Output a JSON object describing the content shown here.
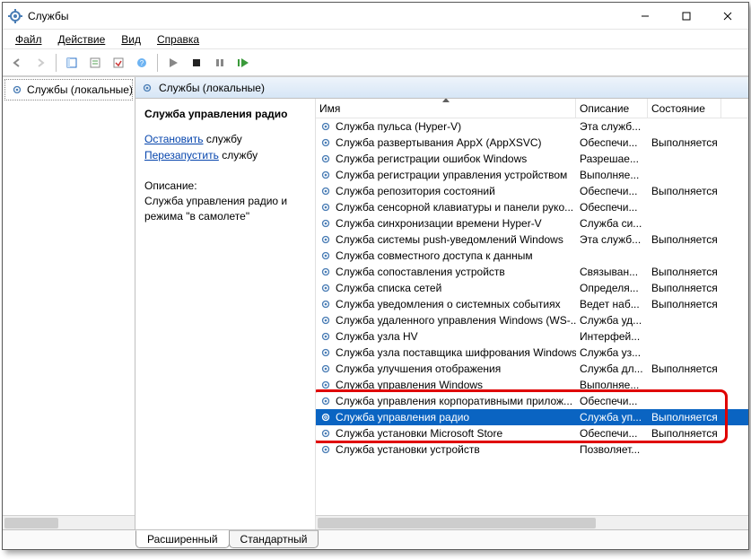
{
  "window": {
    "title": "Службы"
  },
  "menu": {
    "file": "Файл",
    "action": "Действие",
    "view": "Вид",
    "help": "Справка"
  },
  "left": {
    "node": "Службы (локальные)"
  },
  "right_header": "Службы (локальные)",
  "detail": {
    "title": "Служба управления радио",
    "action_stop": "Остановить",
    "action_restart": "Перезапустить",
    "action_suffix": " службу",
    "desc_label": "Описание:",
    "desc_text": "Служба управления радио и режима \"в самолете\""
  },
  "columns": {
    "name": "Имя",
    "desc": "Описание",
    "state": "Состояние"
  },
  "rows": [
    {
      "name": "Служба пульса (Hyper-V)",
      "desc": "Эта служб...",
      "state": ""
    },
    {
      "name": "Служба развертывания AppX (AppXSVC)",
      "desc": "Обеспечи...",
      "state": "Выполняется"
    },
    {
      "name": "Служба регистрации ошибок Windows",
      "desc": "Разрешае...",
      "state": ""
    },
    {
      "name": "Служба регистрации управления устройством",
      "desc": "Выполняе...",
      "state": ""
    },
    {
      "name": "Служба репозитория состояний",
      "desc": "Обеспечи...",
      "state": "Выполняется"
    },
    {
      "name": "Служба сенсорной клавиатуры и панели руко...",
      "desc": "Обеспечи...",
      "state": ""
    },
    {
      "name": "Служба синхронизации времени Hyper-V",
      "desc": "Служба си...",
      "state": ""
    },
    {
      "name": "Служба системы push-уведомлений Windows",
      "desc": "Эта служб...",
      "state": "Выполняется"
    },
    {
      "name": "Служба совместного доступа к данным",
      "desc": "",
      "state": ""
    },
    {
      "name": "Служба сопоставления устройств",
      "desc": "Связыван...",
      "state": "Выполняется"
    },
    {
      "name": "Служба списка сетей",
      "desc": "Определя...",
      "state": "Выполняется"
    },
    {
      "name": "Служба уведомления о системных событиях",
      "desc": "Ведет наб...",
      "state": "Выполняется"
    },
    {
      "name": "Служба удаленного управления Windows (WS-...",
      "desc": "Служба уд...",
      "state": ""
    },
    {
      "name": "Служба узла HV",
      "desc": "Интерфей...",
      "state": ""
    },
    {
      "name": "Служба узла поставщика шифрования Windows",
      "desc": "Служба уз...",
      "state": ""
    },
    {
      "name": "Служба улучшения отображения",
      "desc": "Служба дл...",
      "state": "Выполняется"
    },
    {
      "name": "Служба управления Windows",
      "desc": "Выполняе...",
      "state": ""
    },
    {
      "name": "Служба управления корпоративными прилож...",
      "desc": "Обеспечи...",
      "state": ""
    },
    {
      "name": "Служба управления радио",
      "desc": "Служба уп...",
      "state": "Выполняется",
      "selected": true
    },
    {
      "name": "Служба установки Microsoft Store",
      "desc": "Обеспечи...",
      "state": "Выполняется"
    },
    {
      "name": "Служба установки устройств",
      "desc": "Позволяет...",
      "state": ""
    }
  ],
  "tabs": {
    "extended": "Расширенный",
    "standard": "Стандартный"
  }
}
